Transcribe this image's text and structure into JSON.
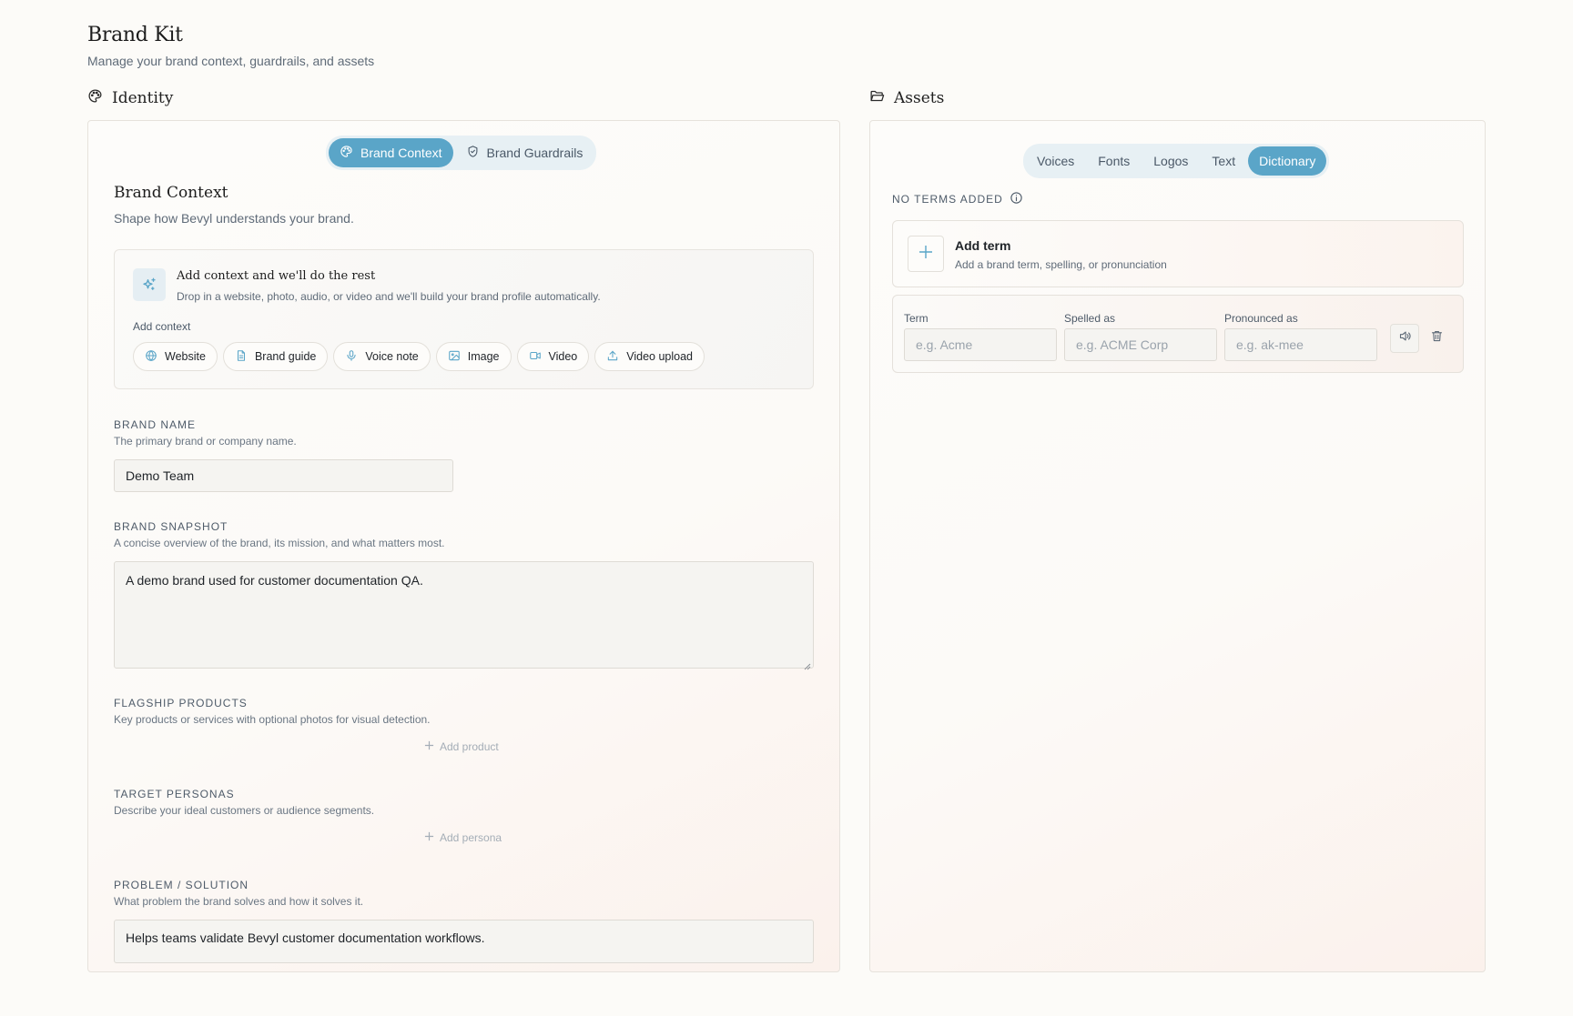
{
  "header": {
    "title": "Brand Kit",
    "subtitle": "Manage your brand context, guardrails, and assets"
  },
  "identity": {
    "section_label": "Identity",
    "tabs": [
      {
        "label": "Brand Context",
        "icon": "palette-icon",
        "active": true
      },
      {
        "label": "Brand Guardrails",
        "icon": "shield-icon",
        "active": false
      }
    ],
    "heading": "Brand Context",
    "description": "Shape how Bevyl understands your brand.",
    "context_card": {
      "title": "Add context and we'll do the rest",
      "description": "Drop in a website, photo, audio, or video and we'll build your brand profile automatically.",
      "add_label": "Add context",
      "chips": [
        {
          "label": "Website",
          "icon": "globe-icon"
        },
        {
          "label": "Brand guide",
          "icon": "document-icon"
        },
        {
          "label": "Voice note",
          "icon": "microphone-icon"
        },
        {
          "label": "Image",
          "icon": "image-icon"
        },
        {
          "label": "Video",
          "icon": "video-icon"
        },
        {
          "label": "Video upload",
          "icon": "upload-icon"
        }
      ]
    },
    "fields": {
      "brand_name": {
        "label": "BRAND NAME",
        "hint": "The primary brand or company name.",
        "value": "Demo Team"
      },
      "brand_snapshot": {
        "label": "BRAND SNAPSHOT",
        "hint": "A concise overview of the brand, its mission, and what matters most.",
        "value": "A demo brand used for customer documentation QA."
      },
      "flagship_products": {
        "label": "FLAGSHIP PRODUCTS",
        "hint": "Key products or services with optional photos for visual detection.",
        "add_label": "Add product"
      },
      "target_personas": {
        "label": "TARGET PERSONAS",
        "hint": "Describe your ideal customers or audience segments.",
        "add_label": "Add persona"
      },
      "problem_solution": {
        "label": "PROBLEM / SOLUTION",
        "hint": "What problem the brand solves and how it solves it.",
        "value": "Helps teams validate Bevyl customer documentation workflows."
      }
    }
  },
  "assets": {
    "section_label": "Assets",
    "tabs": [
      {
        "label": "Voices",
        "active": false
      },
      {
        "label": "Fonts",
        "active": false
      },
      {
        "label": "Logos",
        "active": false
      },
      {
        "label": "Text",
        "active": false
      },
      {
        "label": "Dictionary",
        "active": true
      }
    ],
    "status": "NO TERMS ADDED",
    "add_term": {
      "title": "Add term",
      "description": "Add a brand term, spelling, or pronunciation"
    },
    "term_row": {
      "columns": [
        {
          "label": "Term",
          "placeholder": "e.g. Acme"
        },
        {
          "label": "Spelled as",
          "placeholder": "e.g. ACME Corp"
        },
        {
          "label": "Pronounced as",
          "placeholder": "e.g. ak-mee"
        }
      ]
    }
  },
  "colors": {
    "accent": "#5aa5c8",
    "accent_soft": "#e7f0f4",
    "background": "#fcfbf8",
    "border": "#e6e2dc"
  }
}
